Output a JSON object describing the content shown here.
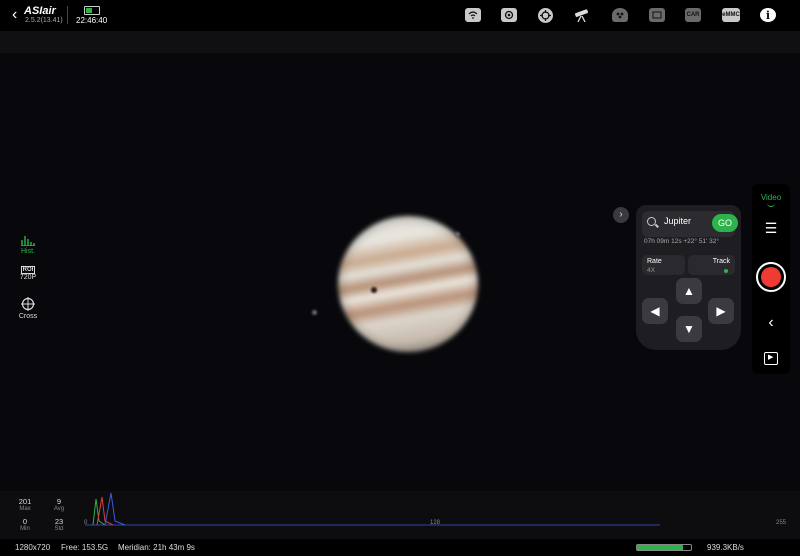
{
  "app": {
    "brand": "ASIair",
    "version": "2.5.2(13.41)",
    "time": "22:46:40"
  },
  "topbar": {
    "icons": [
      "wifi-icon",
      "camera-icon",
      "focuser-icon",
      "telescope-icon",
      "filter-wheel-icon",
      "guide-camera-icon",
      "car-icon",
      "emmc-storage-icon",
      "info-icon"
    ],
    "car_label": "CAR",
    "emmc_label": "eMMC",
    "info_label": "i"
  },
  "left_tools": [
    {
      "label": "Hist.",
      "active": true
    },
    {
      "label": "720P",
      "icon_text": "ROI"
    },
    {
      "label": "Cross"
    }
  ],
  "mount_panel": {
    "collapse_label": "›",
    "target": "Jupiter",
    "go_label": "GO",
    "coords": "07h 09m 12s +22° 51' 32°",
    "rate_label": "Rate",
    "rate_value": "4X",
    "track_label": "Track",
    "track_color": "#2db34a",
    "up": "▲",
    "down": "▼",
    "left": "◀",
    "right": "▶"
  },
  "right_bar": {
    "mode": "Video",
    "menu_label": "☰",
    "back_label": "‹",
    "play_label": "▶"
  },
  "histogram": {
    "max": "201",
    "max_label": "Max",
    "avg": "9",
    "avg_label": "Avg",
    "min": "0",
    "min_label": "Min",
    "std": "23",
    "std_label": "Std",
    "axis": [
      "0",
      "128",
      "255"
    ]
  },
  "status": {
    "resolution": "1280x720",
    "free": "Free: 153.5G",
    "meridian": "Meridian: 21h 43m 9s",
    "progress": 0.85,
    "rate": "939.3KB/s"
  },
  "colors": {
    "accent": "#2db34a",
    "record": "#ef3b32"
  }
}
